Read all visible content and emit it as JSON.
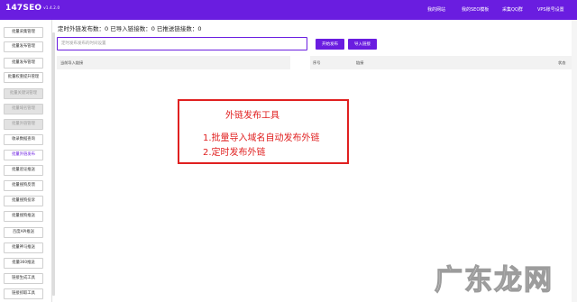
{
  "app": {
    "brand": "147SEO",
    "version": "v1.4.2.0",
    "nav": [
      "我的网站",
      "我的SEO模板",
      "采集QQ群",
      "VPS账号设置"
    ]
  },
  "sidebar": {
    "items": [
      {
        "label": "批量采集管理",
        "state": "normal"
      },
      {
        "label": "批量发布管理",
        "state": "normal"
      },
      {
        "label": "批量发布管理",
        "state": "normal"
      },
      {
        "label": "批量权重提升管理",
        "state": "normal"
      },
      {
        "label": "批量关键词管理",
        "state": "disabled"
      },
      {
        "label": "批量域名管理",
        "state": "disabled"
      },
      {
        "label": "批量外链管理",
        "state": "disabled"
      },
      {
        "label": "收录数据查询",
        "state": "normal"
      },
      {
        "label": "批量外链发布",
        "state": "active"
      },
      {
        "label": "批量验证推送",
        "state": "normal"
      },
      {
        "label": "批量搜狗反馈",
        "state": "normal"
      },
      {
        "label": "批量搜狗投诉",
        "state": "normal"
      },
      {
        "label": "批量搜狗推送",
        "state": "normal"
      },
      {
        "label": "百度API推送",
        "state": "normal"
      },
      {
        "label": "批量神马推送",
        "state": "normal"
      },
      {
        "label": "批量360推送",
        "state": "normal"
      },
      {
        "label": "链接生成工具",
        "state": "normal"
      },
      {
        "label": "链接抓取工具",
        "state": "normal"
      }
    ]
  },
  "main": {
    "stats": "定时外链发布数：0 已导入链接数：0 已推送链接数：0",
    "input": {
      "value": "",
      "placeholder": "定时发布发布的时间设置"
    },
    "buttons": {
      "start": "开始发布",
      "import": "导入链接"
    },
    "left_panel_label": "当前导入链接",
    "table": {
      "headers": [
        "序号",
        "链接",
        "状态"
      ]
    }
  },
  "annotation": {
    "title": "外链发布工具",
    "line1": "1.批量导入域名自动发布外链",
    "line2": "2.定时发布外链"
  },
  "watermark": "广东龙网",
  "colors": {
    "accent": "#6a1de0",
    "annotation": "#e02020"
  }
}
